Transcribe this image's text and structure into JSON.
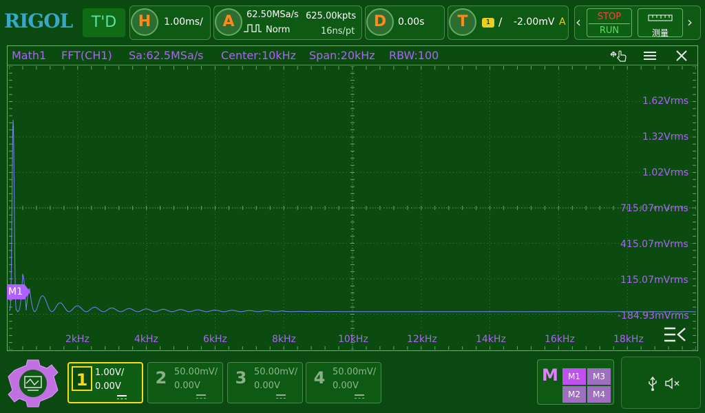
{
  "brand": {
    "logo": "RIGOL",
    "mode": "T'D"
  },
  "horizontal": {
    "icon_letter": "H",
    "timebase": "1.00ms/"
  },
  "acquire": {
    "icon_letter": "A",
    "sample_rate": "62.50MSa/s",
    "mode": "Norm",
    "memory_depth": "625.00kpts",
    "time_per_point": "16ns/pt"
  },
  "delay": {
    "icon_letter": "D",
    "value": "0.00s"
  },
  "trigger": {
    "icon_letter": "T",
    "source": "1",
    "slope_symbol": "/",
    "level": "-2.00mV",
    "sweep": "A"
  },
  "run_control": {
    "stop_label": "STOP",
    "run_label": "RUN"
  },
  "measure": {
    "label": "测量"
  },
  "math_window": {
    "title": "Math1",
    "operation": "FFT(CH1)",
    "sample_rate": "Sa:62.5MSa/s",
    "center": "Center:10kHz",
    "span": "Span:20kHz",
    "rbw": "RBW:100",
    "y_labels": [
      "1.62Vrms",
      "1.32Vrms",
      "1.02Vrms",
      "715.07mVrms",
      "415.07mVrms",
      "115.07mVrms",
      "-184.93mVrms"
    ],
    "x_labels": [
      "2kHz",
      "4kHz",
      "6kHz",
      "8kHz",
      "10kHz",
      "12kHz",
      "14kHz",
      "16kHz",
      "18kHz"
    ],
    "marker_label": "M1"
  },
  "chart_data": {
    "type": "line",
    "series": [
      {
        "x": [
          0,
          200,
          250,
          400,
          500,
          600,
          800,
          1000,
          1200,
          1400,
          1600,
          1800,
          2000,
          2400,
          2800,
          3400,
          4000,
          5000,
          6000,
          8000,
          10000,
          12000,
          14000,
          16000,
          18000,
          20000
        ],
        "y": [
          0.12,
          1.5,
          0.02,
          0.45,
          0.02,
          0.28,
          0.18,
          0.13,
          0.1,
          0.085,
          0.072,
          0.063,
          0.055,
          0.046,
          0.04,
          0.035,
          0.031,
          0.026,
          0.022,
          0.016,
          0.012,
          0.01,
          0.009,
          0.008,
          0.007,
          0.007
        ]
      }
    ],
    "xlim": [
      0,
      20000
    ],
    "ylim": [
      -0.28493,
      1.91507
    ],
    "grid": true
  },
  "channels": [
    {
      "num": "1",
      "scale": "1.00V/",
      "offset": "0.00V"
    },
    {
      "num": "2",
      "scale": "50.00mV/",
      "offset": "0.00V"
    },
    {
      "num": "3",
      "scale": "50.00mV/",
      "offset": "0.00V"
    },
    {
      "num": "4",
      "scale": "50.00mV/",
      "offset": "0.00V"
    }
  ],
  "math_buttons": {
    "label": "M",
    "m1": "M1",
    "m2": "M2",
    "m3": "M3",
    "m4": "M4"
  },
  "colors": {
    "background": "#0a4a10",
    "math_trace": "#b060ff",
    "ch1": "#ffd81a",
    "accent_orange": "#ff8a1a"
  },
  "icons": [
    "gear-icon",
    "usb-icon",
    "mute-icon",
    "move-icon",
    "menu-icon",
    "close-icon",
    "collapse-icon"
  ]
}
